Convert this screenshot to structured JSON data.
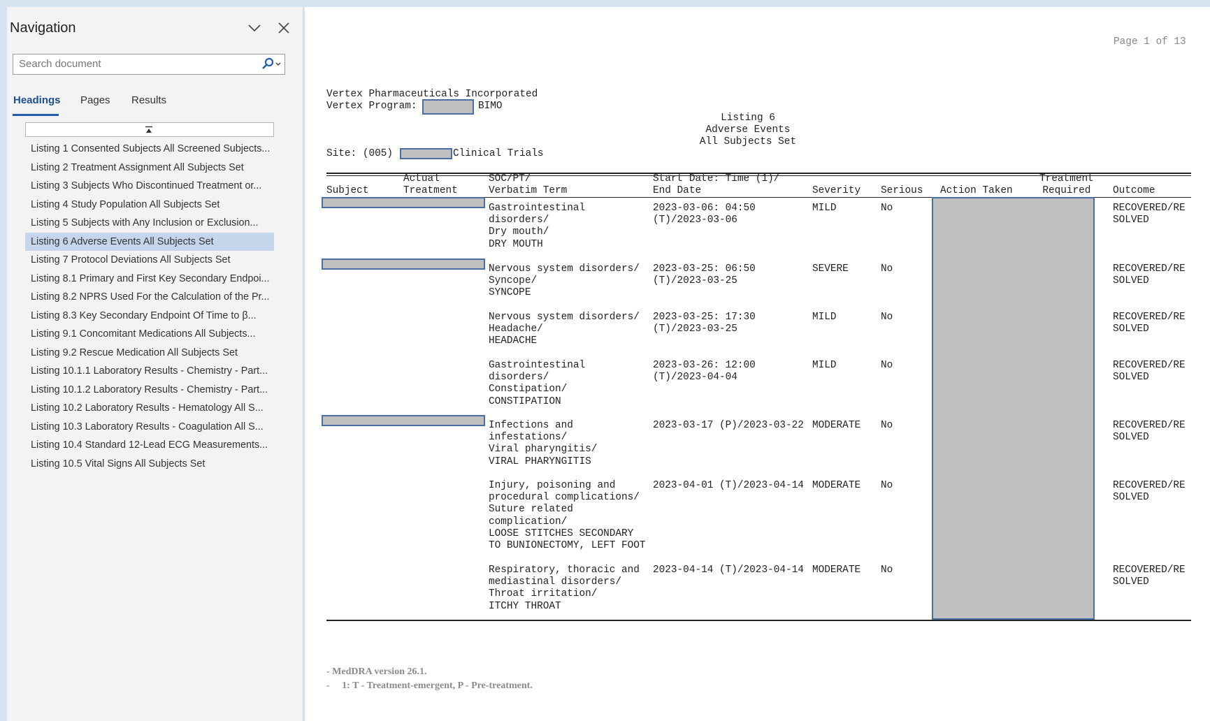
{
  "nav": {
    "title": "Navigation",
    "search_placeholder": "Search document",
    "tabs": [
      "Headings",
      "Pages",
      "Results"
    ],
    "headings": [
      "Listing 1 Consented Subjects All Screened Subjects...",
      "Listing 2 Treatment Assignment All Subjects Set",
      "Listing 3 Subjects Who Discontinued Treatment or...",
      "Listing 4 Study Population All Subjects Set",
      "Listing 5 Subjects with Any Inclusion or Exclusion...",
      "Listing 6 Adverse Events All Subjects Set",
      "Listing 7 Protocol Deviations All Subjects Set",
      "Listing 8.1 Primary and First Key Secondary Endpoi...",
      "Listing 8.2 NPRS Used For the Calculation of the Pr...",
      "Listing 8.3 Key Secondary Endpoint Of Time to β...",
      "Listing 9.1 Concomitant Medications All Subjects...",
      "Listing 9.2 Rescue Medication All Subjects Set",
      "Listing 10.1.1 Laboratory Results - Chemistry - Part...",
      "Listing 10.1.2 Laboratory Results - Chemistry - Part...",
      "Listing 10.2 Laboratory Results - Hematology All S...",
      "Listing 10.3 Laboratory Results - Coagulation All S...",
      "Listing 10.4 Standard 12-Lead ECG Measurements...",
      "Listing 10.5 Vital Signs All Subjects Set"
    ],
    "selected_index": 5
  },
  "doc": {
    "page_label": "Page 1 of 13",
    "company": "Vertex Pharmaceuticals Incorporated",
    "program_label": "Vertex Program:",
    "program_suffix": "BIMO",
    "listing_title": "Listing 6",
    "listing_subtitle": "Adverse Events",
    "listing_set": "All Subjects Set",
    "site_label": "Site: (005)",
    "site_suffix": "Clinical Trials",
    "columns": {
      "subject": "Subject",
      "actual_treatment": "Actual\nTreatment",
      "soc": "SOC/PT/\nVerbatim Term",
      "dates": "Start Date: Time (1)/\nEnd Date",
      "severity": "Severity",
      "serious": "Serious",
      "action": "Action Taken",
      "treatment_required": "Treatment\nRequired",
      "outcome": "Outcome"
    },
    "rows": [
      {
        "soc": "Gastrointestinal\ndisorders/\nDry mouth/\nDRY MOUTH",
        "dates": "2023-03-06: 04:50\n(T)/2023-03-06",
        "severity": "MILD",
        "serious": "No",
        "outcome": "RECOVERED/RE\nSOLVED"
      },
      {
        "soc": "Nervous system disorders/\nSyncope/\nSYNCOPE",
        "dates": "2023-03-25: 06:50\n(T)/2023-03-25",
        "severity": "SEVERE",
        "serious": "No",
        "outcome": "RECOVERED/RE\nSOLVED"
      },
      {
        "soc": "Nervous system disorders/\nHeadache/\nHEADACHE",
        "dates": "2023-03-25: 17:30\n(T)/2023-03-25",
        "severity": "MILD",
        "serious": "No",
        "outcome": "RECOVERED/RE\nSOLVED"
      },
      {
        "soc": "Gastrointestinal\ndisorders/\nConstipation/\nCONSTIPATION",
        "dates": "2023-03-26: 12:00\n(T)/2023-04-04",
        "severity": "MILD",
        "serious": "No",
        "outcome": "RECOVERED/RE\nSOLVED"
      },
      {
        "soc": "Infections and\ninfestations/\nViral pharyngitis/\nVIRAL PHARYNGITIS",
        "dates": "2023-03-17 (P)/2023-03-22",
        "severity": "MODERATE",
        "serious": "No",
        "outcome": "RECOVERED/RE\nSOLVED"
      },
      {
        "soc": "Injury, poisoning and\nprocedural complications/\nSuture related\ncomplication/\nLOOSE STITCHES SECONDARY\nTO BUNIONECTOMY, LEFT FOOT",
        "dates": "2023-04-01 (T)/2023-04-14",
        "severity": "MODERATE",
        "serious": "No",
        "outcome": "RECOVERED/RE\nSOLVED"
      },
      {
        "soc": "Respiratory, thoracic and\nmediastinal disorders/\nThroat irritation/\nITCHY THROAT",
        "dates": "2023-04-14 (T)/2023-04-14",
        "severity": "MODERATE",
        "serious": "No",
        "outcome": "RECOVERED/RE\nSOLVED"
      }
    ],
    "footnotes": [
      "- MedDRA version 26.1.",
      "-     1: T - Treatment-emergent, P - Pre-treatment."
    ]
  }
}
